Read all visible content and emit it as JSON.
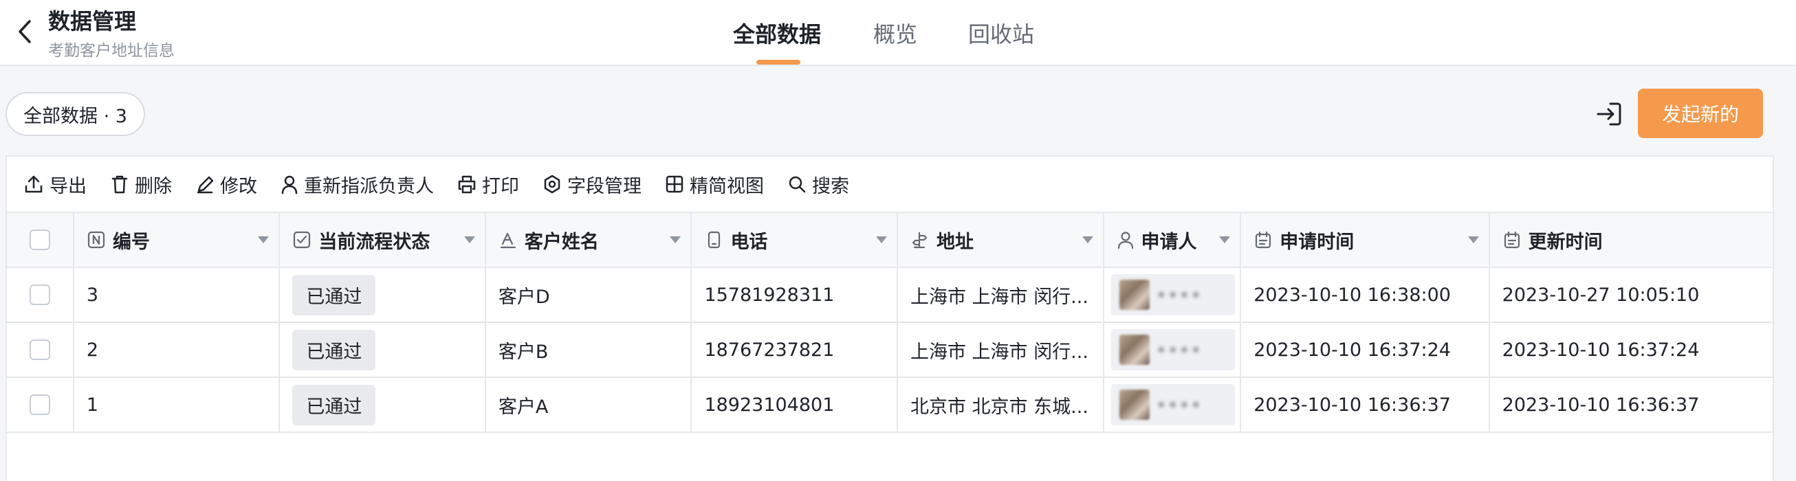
{
  "header": {
    "title": "数据管理",
    "subtitle": "考勤客户地址信息",
    "tabs": [
      {
        "label": "全部数据",
        "active": true
      },
      {
        "label": "概览",
        "active": false
      },
      {
        "label": "回收站",
        "active": false
      }
    ]
  },
  "filter_chip": "全部数据 · 3",
  "primary_button": "发起新的",
  "toolbar": [
    {
      "label": "导出",
      "icon": "upload-icon"
    },
    {
      "label": "删除",
      "icon": "trash-icon"
    },
    {
      "label": "修改",
      "icon": "pencil-icon"
    },
    {
      "label": "重新指派负责人",
      "icon": "user-icon"
    },
    {
      "label": "打印",
      "icon": "printer-icon"
    },
    {
      "label": "字段管理",
      "icon": "settings-icon"
    },
    {
      "label": "精简视图",
      "icon": "grid-icon"
    },
    {
      "label": "搜索",
      "icon": "search-icon"
    }
  ],
  "table": {
    "columns": [
      "编号",
      "当前流程状态",
      "客户姓名",
      "电话",
      "地址",
      "申请人",
      "申请时间",
      "更新时间"
    ],
    "rows": [
      {
        "id": "3",
        "status": "已通过",
        "name": "客户D",
        "phone": "15781928311",
        "address": "上海市 上海市 闵行...",
        "applicant": "••••",
        "applied": "2023-10-10 16:38:00",
        "updated": "2023-10-27 10:05:10"
      },
      {
        "id": "2",
        "status": "已通过",
        "name": "客户B",
        "phone": "18767237821",
        "address": "上海市 上海市 闵行...",
        "applicant": "••••",
        "applied": "2023-10-10 16:37:24",
        "updated": "2023-10-10 16:37:24"
      },
      {
        "id": "1",
        "status": "已通过",
        "name": "客户A",
        "phone": "18923104801",
        "address": "北京市 北京市 东城...",
        "applicant": "••••",
        "applied": "2023-10-10 16:36:37",
        "updated": "2023-10-10 16:36:37"
      }
    ]
  },
  "colors": {
    "accent": "#f59a4c",
    "border": "#e6e8eb",
    "text": "#1f2329",
    "muted": "#8f959e"
  }
}
